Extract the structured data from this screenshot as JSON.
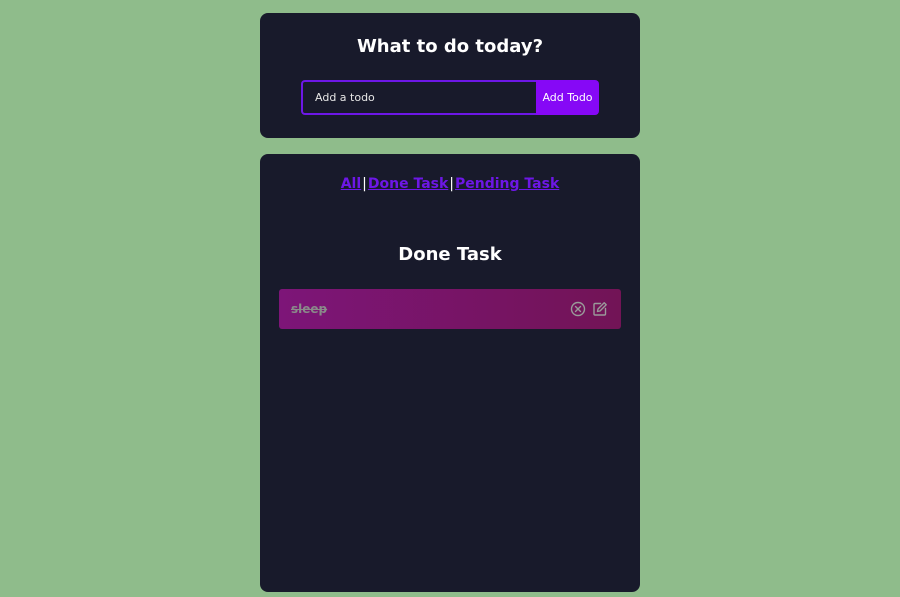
{
  "top_card": {
    "title": "What to do today?",
    "input_placeholder": "Add a todo",
    "add_button_label": "Add Todo"
  },
  "filters": {
    "all": "All",
    "done": "Done Task",
    "pending": "Pending Task",
    "separator": "|"
  },
  "list_section": {
    "title": "Done Task",
    "items": [
      {
        "text": "sleep",
        "icons": [
          "close-circle-icon",
          "edit-icon"
        ]
      }
    ]
  },
  "colors": {
    "page_background": "#8fbc8b",
    "card_background": "#181a2b",
    "accent": "#6d17e6",
    "button": "#8608f6",
    "item_gradient_start": "#7d1578",
    "item_gradient_end": "#721456"
  }
}
